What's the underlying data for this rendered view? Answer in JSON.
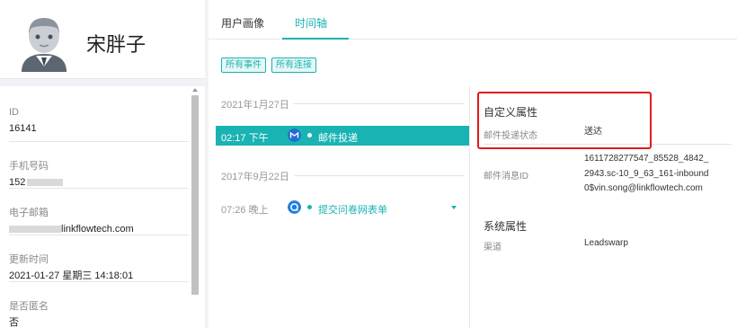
{
  "profile": {
    "name": "宋胖子"
  },
  "fields": [
    {
      "label": "ID",
      "value": "16141"
    },
    {
      "label": "手机号码",
      "value": "152"
    },
    {
      "label": "电子邮箱",
      "value": "linkflowtech.com"
    },
    {
      "label": "更新时间",
      "value": "2021-01-27 星期三 14:18:01"
    },
    {
      "label": "是否匿名",
      "value": "否"
    }
  ],
  "tabs": [
    {
      "label": "用户画像",
      "active": false
    },
    {
      "label": "时间轴",
      "active": true
    }
  ],
  "filters": [
    "所有事件",
    "所有连接"
  ],
  "timeline": {
    "groups": [
      {
        "date": "2021年1月27日",
        "events": [
          {
            "time": "02:17 下午",
            "title": "邮件投递",
            "icon": "mail-event-icon",
            "selected": true
          }
        ]
      },
      {
        "date": "2017年9月22日",
        "events": [
          {
            "time": "07:26 晚上",
            "title": "提交问卷网表单",
            "icon": "form-event-icon",
            "selected": false
          }
        ]
      }
    ]
  },
  "details": {
    "custom_title": "自定义属性",
    "custom_props": [
      {
        "key": "邮件投递状态",
        "value": "送达"
      },
      {
        "key": "邮件消息ID",
        "value_lines": [
          "1611728277547_85528_4842_",
          "2943.sc-10_9_63_161-inbound",
          "0$vin.song@linkflowtech.com"
        ]
      }
    ],
    "system_title": "系统属性",
    "system_props": [
      {
        "key": "渠道",
        "value": "Leadswarp"
      }
    ]
  },
  "colors": {
    "accent": "#19b3b3",
    "highlight": "#e21b1b",
    "mail_icon": "#1f6fd1",
    "form_icon": "#1e7ee0"
  }
}
